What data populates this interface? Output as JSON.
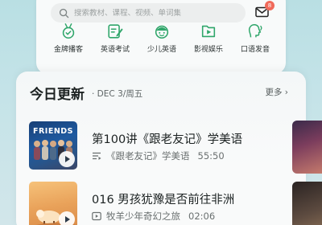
{
  "search": {
    "placeholder": "搜索教材、课程、视频、单词集"
  },
  "mail": {
    "badge": "8"
  },
  "categories": [
    {
      "label": "金牌播客",
      "icon": "medal-icon"
    },
    {
      "label": "英语考试",
      "icon": "exam-pencil-icon"
    },
    {
      "label": "少儿英语",
      "icon": "child-face-icon"
    },
    {
      "label": "影视娱乐",
      "icon": "video-play-icon"
    },
    {
      "label": "口语发音",
      "icon": "speech-icon"
    }
  ],
  "colors": {
    "accent_green": "#2fa66a",
    "badge_red": "#f06a5a"
  },
  "today": {
    "title": "今日更新",
    "date": "· DEC 3/周五",
    "more": "更多 ›",
    "items": [
      {
        "title": "第100讲《跟老友记》学美语",
        "album": "《跟老友记》学美语",
        "duration": "55:50",
        "meta_icon": "playlist-icon",
        "thumb_text": "FRIENDS"
      },
      {
        "title": "016 男孩犹豫是否前往非洲",
        "album": "牧羊少年奇幻之旅",
        "duration": "02:06",
        "meta_icon": "video-icon"
      }
    ]
  }
}
